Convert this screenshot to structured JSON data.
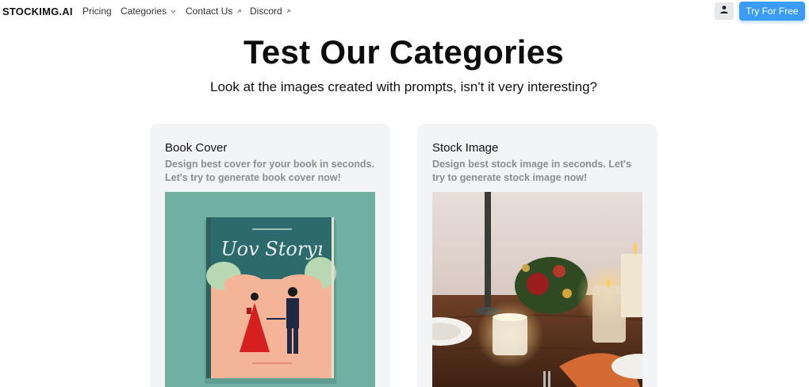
{
  "nav": {
    "logo": "STOCKIMG.AI",
    "pricing": "Pricing",
    "categories": "Categories",
    "contact": "Contact Us",
    "discord": "Discord",
    "cta": "Try For Free"
  },
  "hero": {
    "title": "Test Our Categories",
    "subtitle": "Look at the images created with prompts, isn't it very interesting?"
  },
  "cards": [
    {
      "title": "Book Cover",
      "description": "Design best cover for your book in seconds. Let's try to generate book cover now!",
      "image_title": "Uov Storyı"
    },
    {
      "title": "Stock Image",
      "description": "Design best stock image in seconds. Let's try to generate stock image now!"
    }
  ],
  "colors": {
    "accent": "#3b9cf5",
    "card_bg": "#f3f4f6",
    "muted_text": "#8a8d92"
  },
  "icons": {
    "categories": "chevron-down-icon",
    "external": "external-link-icon",
    "user": "user-icon"
  }
}
